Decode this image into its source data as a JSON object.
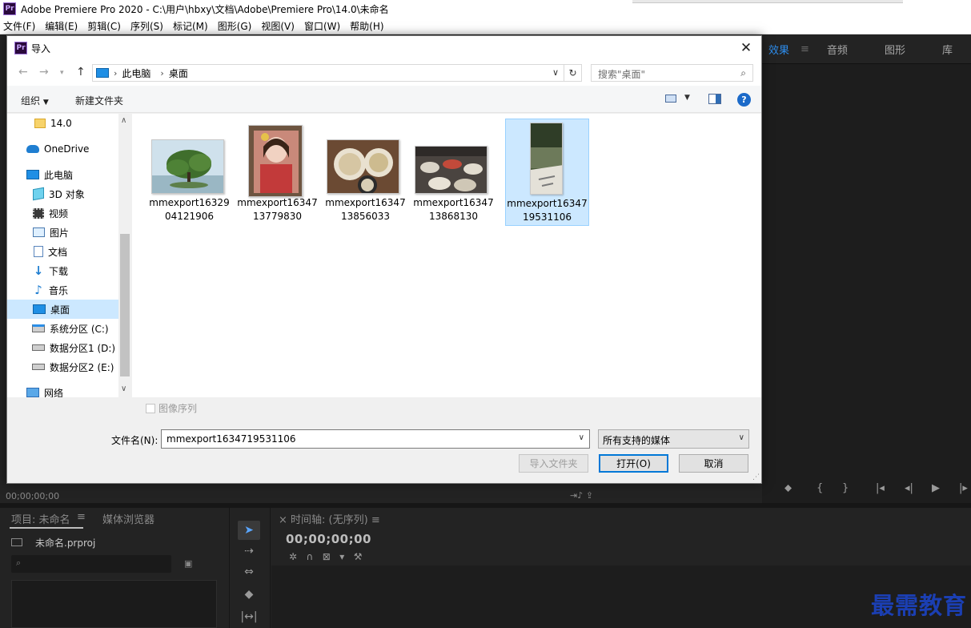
{
  "app": {
    "title": "Adobe Premiere Pro 2020 - C:\\用户\\hbxy\\文档\\Adobe\\Premiere Pro\\14.0\\未命名",
    "logo_text": "Pr",
    "menu": [
      "文件(F)",
      "编辑(E)",
      "剪辑(C)",
      "序列(S)",
      "标记(M)",
      "图形(G)",
      "视图(V)",
      "窗口(W)",
      "帮助(H)"
    ],
    "right_tabs": {
      "effects": "效果",
      "audio": "音频",
      "graphics": "图形",
      "library": "库"
    },
    "left_timecode": "00;00;00;00",
    "project_panel": {
      "title": "项目: 未命名",
      "media_browser": "媒体浏览器",
      "file": "未命名.prproj"
    },
    "timeline_panel": {
      "title": "时间轴: (无序列)",
      "timecode": "00;00;00;00"
    },
    "watermark": "最需教育"
  },
  "dialog": {
    "title": "导入",
    "icon_text": "Pr",
    "breadcrumb": [
      "此电脑",
      "桌面"
    ],
    "search_placeholder": "搜索\"桌面\"",
    "organize": "组织",
    "new_folder": "新建文件夹",
    "nav_items": [
      {
        "label": "14.0",
        "icon": "folder-icon"
      },
      {
        "label": "OneDrive",
        "icon": "cloud-icon"
      },
      {
        "label": "此电脑",
        "icon": "computer-icon"
      },
      {
        "label": "3D 对象",
        "icon": "cube-icon"
      },
      {
        "label": "视频",
        "icon": "video-icon"
      },
      {
        "label": "图片",
        "icon": "picture-icon"
      },
      {
        "label": "文档",
        "icon": "document-icon"
      },
      {
        "label": "下载",
        "icon": "download-icon"
      },
      {
        "label": "音乐",
        "icon": "music-icon"
      },
      {
        "label": "桌面",
        "icon": "desktop-icon",
        "selected": true
      },
      {
        "label": "系统分区 (C:)",
        "icon": "system-drive-icon"
      },
      {
        "label": "数据分区1 (D:)",
        "icon": "drive-icon"
      },
      {
        "label": "数据分区2 (E:)",
        "icon": "drive-icon"
      },
      {
        "label": "网络",
        "icon": "network-icon"
      }
    ],
    "files": [
      {
        "name": "mmexport1632904121906",
        "thumb": "tree"
      },
      {
        "name": "mmexport1634713779830",
        "thumb": "portrait"
      },
      {
        "name": "mmexport1634713856033",
        "thumb": "soup"
      },
      {
        "name": "mmexport1634713868130",
        "thumb": "table"
      },
      {
        "name": "mmexport1634719531106",
        "thumb": "path",
        "selected": true
      }
    ],
    "image_sequence": "图像序列",
    "filename_label": "文件名(N):",
    "filename_value": "mmexport1634719531106",
    "filetype": "所有支持的媒体",
    "import_folder": "导入文件夹",
    "open": "打开(O)",
    "cancel": "取消"
  }
}
